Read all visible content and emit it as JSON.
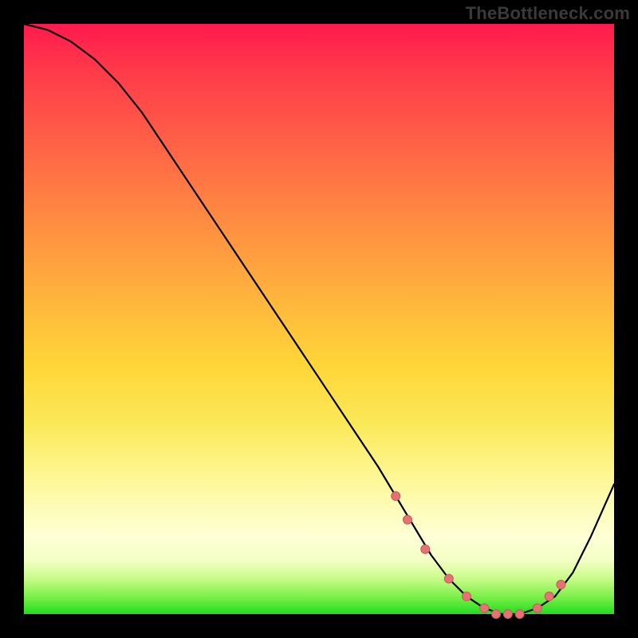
{
  "watermark": "TheBottleneck.com",
  "colors": {
    "curve_stroke": "#000000",
    "dot_fill": "#e57373",
    "dot_stroke": "#c75a5a"
  },
  "chart_data": {
    "type": "line",
    "title": "",
    "xlabel": "",
    "ylabel": "",
    "xlim": [
      0,
      100
    ],
    "ylim": [
      0,
      100
    ],
    "series": [
      {
        "name": "bottleneck-curve",
        "x": [
          0,
          4,
          8,
          12,
          16,
          20,
          24,
          28,
          32,
          36,
          40,
          44,
          48,
          52,
          56,
          60,
          63,
          66,
          69,
          72,
          75,
          78,
          81,
          84,
          87,
          90,
          93,
          96,
          100
        ],
        "y": [
          100,
          99,
          97,
          94,
          90,
          85,
          79,
          73,
          67,
          61,
          55,
          49,
          43,
          37,
          31,
          25,
          20,
          15,
          10,
          6,
          3,
          1,
          0,
          0,
          1,
          3,
          7,
          13,
          22
        ]
      }
    ],
    "dots": {
      "name": "highlight-dots",
      "x": [
        63,
        65,
        68,
        72,
        75,
        78,
        80,
        82,
        84,
        87,
        89,
        91
      ],
      "y": [
        20,
        16,
        11,
        6,
        3,
        1,
        0,
        0,
        0,
        1,
        3,
        5
      ]
    }
  }
}
